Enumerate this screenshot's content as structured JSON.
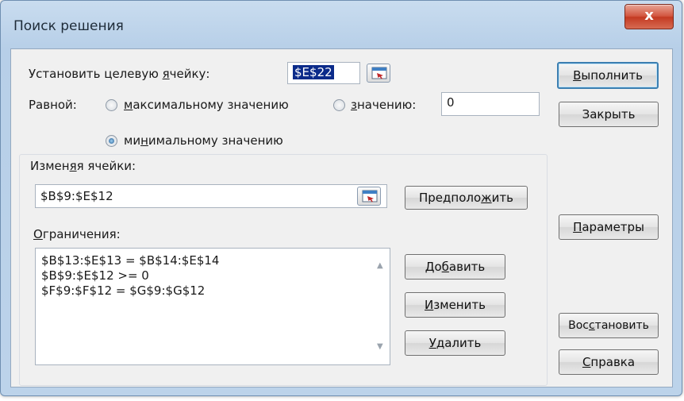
{
  "window": {
    "title": "Поиск решения",
    "close_glyph": "x"
  },
  "target": {
    "label_pre": "Установить целевую ",
    "label_mnemonic": "я",
    "label_post": "чейку:",
    "value": "$E$22"
  },
  "equal_to": {
    "label": "Равной:",
    "max": {
      "mn": "м",
      "rest": "аксимальному значению",
      "selected": false
    },
    "value_option": {
      "mn": "з",
      "rest": "начению:",
      "selected": false
    },
    "value_input": "0",
    "min": {
      "pre": "ми",
      "mn": "н",
      "rest": "имальному значению",
      "selected": true
    }
  },
  "changing": {
    "label_pre": "Измен",
    "label_mnemonic": "я",
    "label_post": "я ячейки:",
    "value": "$B$9:$E$12",
    "guess_pre": "Предполо",
    "guess_mn": "ж",
    "guess_post": "ить"
  },
  "constraints": {
    "label_mn": "О",
    "label_rest": "граничения:",
    "items": [
      "$B$13:$E$13 = $B$14:$E$14",
      "$B$9:$E$12 >= 0",
      "$F$9:$F$12 = $G$9:$G$12"
    ],
    "add": {
      "pre": "До",
      "mn": "б",
      "post": "авить"
    },
    "change": {
      "pre": "",
      "mn": "И",
      "post": "зменить"
    },
    "delete": {
      "pre": "",
      "mn": "У",
      "post": "далить"
    }
  },
  "buttons": {
    "solve": {
      "pre": "",
      "mn": "В",
      "post": "ыполнить"
    },
    "close": "Закрыть",
    "options": {
      "pre": "",
      "mn": "П",
      "post": "араметры"
    },
    "reset": {
      "pre": "Вос",
      "mn": "с",
      "post": "тановить"
    },
    "help": {
      "pre": "",
      "mn": "С",
      "post": "правка"
    }
  }
}
